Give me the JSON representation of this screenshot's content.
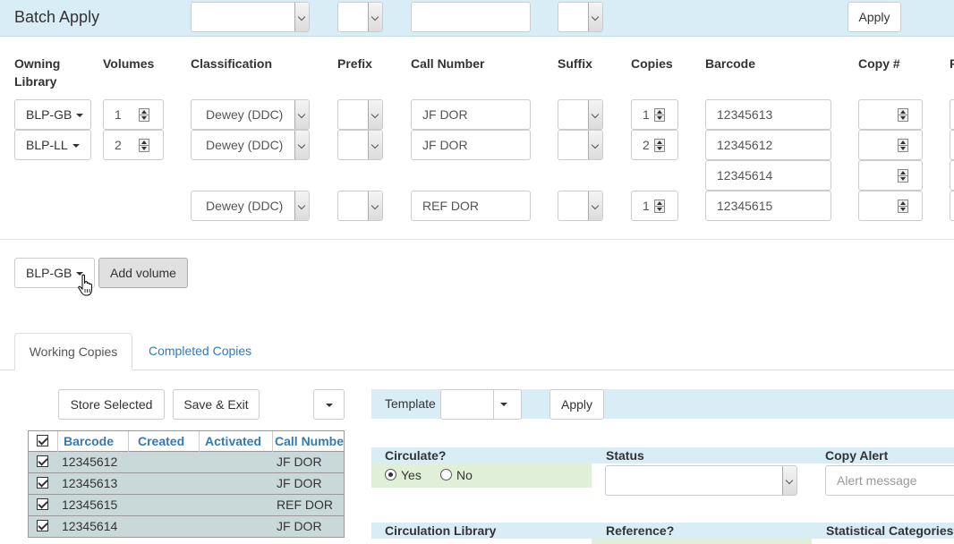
{
  "batch": {
    "title": "Batch Apply",
    "apply_label": "Apply"
  },
  "columns": {
    "owning_library": "Owning Library",
    "volumes": "Volumes",
    "classification": "Classification",
    "prefix": "Prefix",
    "call_number": "Call Number",
    "suffix": "Suffix",
    "copies": "Copies",
    "barcode": "Barcode",
    "copy_num": "Copy #",
    "next_col_initial": "P"
  },
  "rows": [
    {
      "library": "BLP-GB",
      "volumes": "1",
      "classification": "Dewey (DDC)",
      "prefix": "",
      "call_number": "JF DOR",
      "suffix": "",
      "copies": "1",
      "barcode": "12345613",
      "copy_num": ""
    },
    {
      "library": "BLP-LL",
      "volumes": "2",
      "classification": "Dewey (DDC)",
      "prefix": "",
      "call_number": "JF DOR",
      "suffix": "",
      "copies": "2",
      "barcode": "12345612",
      "copy_num": ""
    },
    {
      "barcode": "12345614",
      "copy_num": ""
    },
    {
      "classification": "Dewey (DDC)",
      "prefix": "",
      "call_number": "REF DOR",
      "suffix": "",
      "copies": "1",
      "barcode": "12345615",
      "copy_num": ""
    }
  ],
  "add_volume": {
    "library": "BLP-GB",
    "button_label": "Add volume"
  },
  "tabs": {
    "working": "Working Copies",
    "completed": "Completed Copies"
  },
  "grid_actions": {
    "store_selected": "Store Selected",
    "save_exit": "Save & Exit"
  },
  "grid": {
    "headers": [
      "Barcode",
      "Created",
      "Activated",
      "Call Number"
    ],
    "rows": [
      {
        "barcode": "12345612",
        "created": "",
        "activated": "",
        "call_number": "JF DOR"
      },
      {
        "barcode": "12345613",
        "created": "",
        "activated": "",
        "call_number": "JF DOR"
      },
      {
        "barcode": "12345615",
        "created": "",
        "activated": "",
        "call_number": "REF DOR"
      },
      {
        "barcode": "12345614",
        "created": "",
        "activated": "",
        "call_number": "JF DOR"
      }
    ]
  },
  "template": {
    "label": "Template",
    "value": "",
    "apply_label": "Apply"
  },
  "fields": {
    "circulate": "Circulate?",
    "circulate_yes": "Yes",
    "circulate_no": "No",
    "circulate_selected": "Yes",
    "status": "Status",
    "status_value": "",
    "copy_alert": "Copy Alert",
    "copy_alert_placeholder": "Alert message",
    "circ_library": "Circulation Library",
    "reference": "Reference?",
    "stat_categories": "Statistical Categories"
  },
  "colors": {
    "accent_blue": "#337ab7",
    "bar_blue": "#d9edf7",
    "row_selected": "#c9d9d9",
    "green_field": "#e0f0d8"
  }
}
